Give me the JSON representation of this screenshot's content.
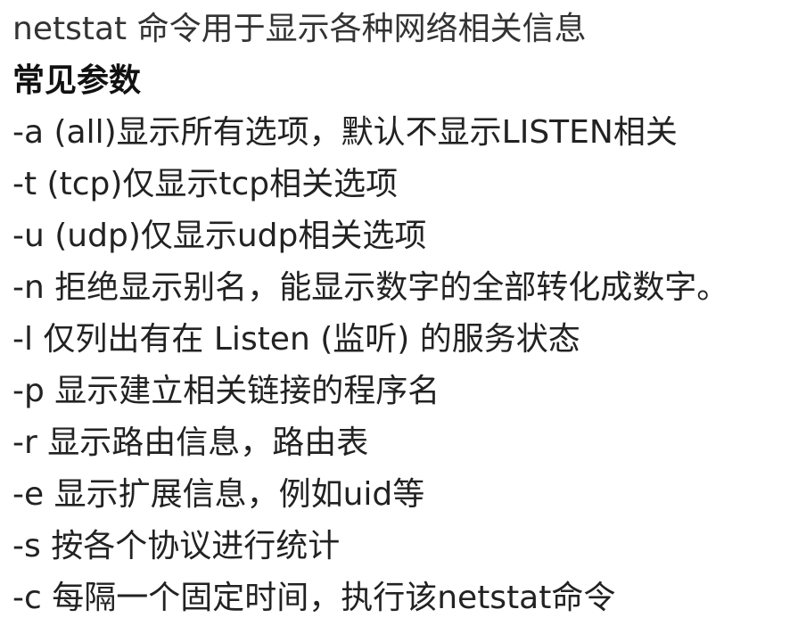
{
  "intro": "netstat 命令用于显示各种网络相关信息",
  "heading": "常见参数",
  "params": [
    "-a (all)显示所有选项，默认不显示LISTEN相关",
    "-t (tcp)仅显示tcp相关选项",
    "-u (udp)仅显示udp相关选项",
    "-n 拒绝显示别名，能显示数字的全部转化成数字。",
    "-l 仅列出有在 Listen (监听) 的服务状态",
    "-p 显示建立相关链接的程序名",
    "-r 显示路由信息，路由表",
    "-e 显示扩展信息，例如uid等",
    "-s 按各个协议进行统计",
    "-c 每隔一个固定时间，执行该netstat命令"
  ]
}
